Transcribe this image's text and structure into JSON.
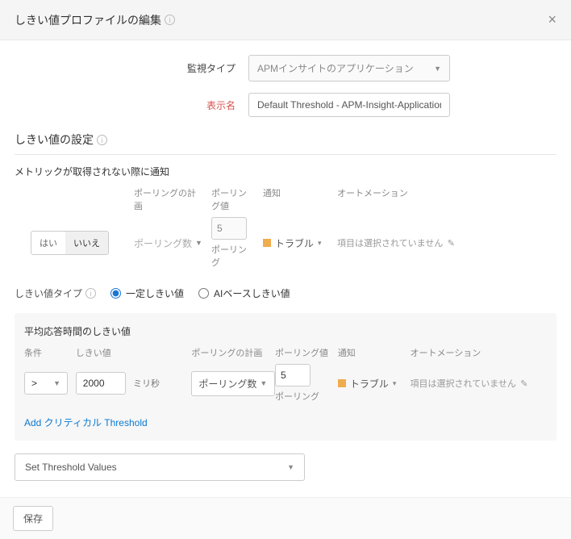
{
  "header": {
    "title": "しきい値プロファイルの編集"
  },
  "form": {
    "monitor_type_label": "監視タイプ",
    "monitor_type_value": "APMインサイトのアプリケーション",
    "display_name_label": "表示名",
    "display_name_value": "Default Threshold - APM-Insight-Application"
  },
  "threshold_settings": {
    "title": "しきい値の設定",
    "notify_label": "メトリックが取得されない際に通知",
    "headers": {
      "polling_plan": "ポーリングの計画",
      "polling_value": "ポーリング値",
      "notification": "通知",
      "automation": "オートメーション"
    },
    "toggle": {
      "yes": "はい",
      "no": "いいえ"
    },
    "polling_plan_value": "ポーリング数",
    "polling_value": "5",
    "polling_unit": "ポーリング",
    "status": "トラブル",
    "automation_text": "項目は選択されていません"
  },
  "threshold_type": {
    "label": "しきい値タイプ",
    "fixed": "一定しきい値",
    "ai": "AIベースしきい値"
  },
  "panel": {
    "title": "平均応答時間のしきい値",
    "headers": {
      "condition": "条件",
      "threshold": "しきい値",
      "polling_plan": "ポーリングの計画",
      "polling_value": "ポーリング値",
      "notification": "通知",
      "automation": "オートメーション"
    },
    "condition": ">",
    "threshold_value": "2000",
    "threshold_unit": "ミリ秒",
    "polling_plan_value": "ポーリング数",
    "polling_value": "5",
    "polling_unit": "ポーリング",
    "status": "トラブル",
    "automation_text": "項目は選択されていません",
    "add_link": "Add クリティカル Threshold"
  },
  "set_threshold": "Set Threshold Values",
  "footer": {
    "save": "保存"
  }
}
